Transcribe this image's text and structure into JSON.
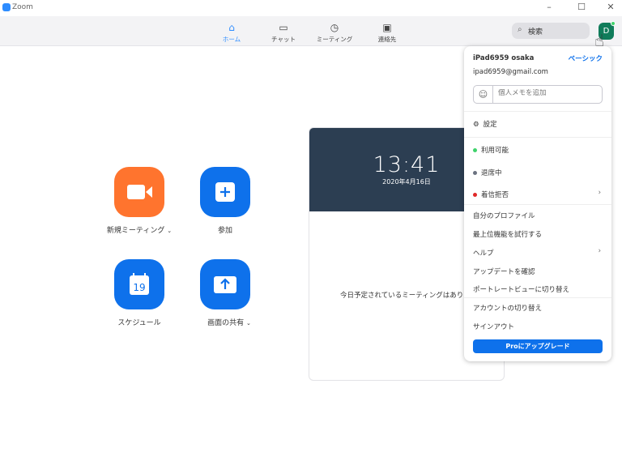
{
  "window": {
    "title": "Zoom",
    "controls": [
      "minimize",
      "maximize",
      "close"
    ]
  },
  "tabs": [
    {
      "label": "ホーム",
      "icon": "home-icon",
      "active": true
    },
    {
      "label": "チャット",
      "icon": "chat-icon"
    },
    {
      "label": "ミーティング",
      "icon": "clock-icon"
    },
    {
      "label": "連絡先",
      "icon": "contacts-icon"
    }
  ],
  "search": {
    "placeholder": "検索"
  },
  "avatar": {
    "initial": "D",
    "status_color": "#3fd26b"
  },
  "actions": [
    {
      "label": "新規ミーティング",
      "color": "#ff742e",
      "icon": "video-camera-icon",
      "dropdown": true
    },
    {
      "label": "参加",
      "color": "#0e71eb",
      "icon": "plus-icon"
    },
    {
      "label": "スケジュール",
      "color": "#0e71eb",
      "icon": "calendar-icon",
      "calendar_day": "19"
    },
    {
      "label": "画面の共有",
      "color": "#0e71eb",
      "icon": "share-up-arrow-icon",
      "dropdown": true
    }
  ],
  "card": {
    "time": "13:41",
    "date": "2020年4月16日",
    "no_meetings": "今日予定されているミーティングはありません"
  },
  "menu": {
    "name": "iPad6959 osaka",
    "plan": "ベーシック",
    "email": "ipad6959@gmail.com",
    "memo_placeholder": "個人メモを追加",
    "settings": "設定",
    "statuses": [
      {
        "label": "利用可能",
        "color": "#3fd26b"
      },
      {
        "label": "退席中",
        "color": "#6b7280"
      },
      {
        "label": "着信拒否",
        "color": "#e02828",
        "submenu": true
      }
    ],
    "items": [
      "自分のプロファイル",
      "最上位機能を試行する",
      "ヘルプ",
      "アップデートを確認",
      "ポートレートビューに切り替え",
      "アカウントの切り替え",
      "サインアウト"
    ],
    "upgrade": "Proにアップグレード"
  }
}
